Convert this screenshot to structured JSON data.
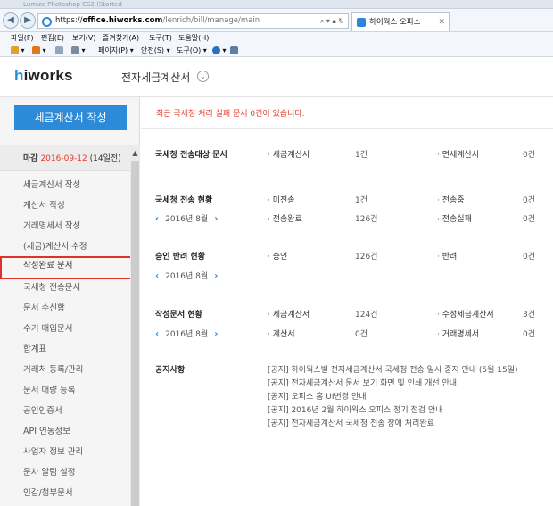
{
  "browser": {
    "window_title": "Lumize Photoshop CS2 (Started",
    "url_scheme": "https://",
    "url_host": "office.hiworks.com",
    "url_path": "/lenrich/bill/manage/main",
    "tab_label": "하이웍스 오피스",
    "menu": [
      "파일(F)",
      "편집(E)",
      "보기(V)",
      "즐겨찾기(A)",
      "도구(T)",
      "도움말(H)"
    ],
    "commands": [
      "페이지(P) ▾",
      "안전(S) ▾",
      "도구(O) ▾"
    ]
  },
  "header": {
    "logo_h": "h",
    "logo_rest": "iworks",
    "app_title": "전자세금계산서"
  },
  "sidebar": {
    "write_button": "세금계산서 작성",
    "deadline_label": "마감",
    "deadline_date": "2016-09-12",
    "deadline_remaining": "(14일전)",
    "items": [
      "세금계산서 작성",
      "계산서 작성",
      "거래명세서 작성",
      "(세금)계산서 수정",
      "작성완료 문서",
      "국세청 전송문서",
      "문서 수신함",
      "수기 매입문서",
      "합계표",
      "거래처 등록/관리",
      "문서 대량 등록",
      "공인인증서",
      "API 연동정보",
      "사업자 정보 관리",
      "문자 알림 설정",
      "인감/첨부문서"
    ],
    "active_index": 4
  },
  "main": {
    "red_notice": "최근 국세청 처리 실패 문서 0건이 있습니다.",
    "sections": [
      {
        "title": "국세청 전송대상 문서",
        "rows": [
          {
            "a_label": "세금계산서",
            "a_value": "1건",
            "b_label": "면세계산서",
            "b_value": "0건"
          }
        ]
      },
      {
        "title": "국세청 전송 현황",
        "month": "2016년 8월",
        "rows": [
          {
            "a_label": "미전송",
            "a_value": "1건",
            "b_label": "전송중",
            "b_value": "0건"
          },
          {
            "a_label": "전송완료",
            "a_value": "126건",
            "b_label": "전송실패",
            "b_value": "0건"
          }
        ]
      },
      {
        "title": "승인 반려 현황",
        "month": "2016년 8월",
        "rows": [
          {
            "a_label": "승인",
            "a_value": "126건",
            "b_label": "반려",
            "b_value": "0건"
          }
        ]
      },
      {
        "title": "작성문서 현황",
        "month": "2016년 8월",
        "rows": [
          {
            "a_label": "세금계산서",
            "a_value": "124건",
            "b_label": "수정세금계산서",
            "b_value": "3건"
          },
          {
            "a_label": "계산서",
            "a_value": "0건",
            "b_label": "거래명세서",
            "b_value": "0건"
          }
        ]
      }
    ],
    "notice_title": "공지사항",
    "notices": [
      "[공지] 하이웍스빌 전자세금계산서 국세청 전송 일시 중지 안내 (5월 15일)",
      "[공지] 전자세금계산서 문서 보기 화면 및 인쇄 개선 안내",
      "[공지] 오피스 홈 UI변경 안내",
      "[공지] 2016년 2월 하이웍스 오피스 정기 점검 안내",
      "[공지] 전자세금계산서 국세청 전송 장애 처리완료"
    ]
  },
  "colors": {
    "accent_blue": "#2c8ad8",
    "alert_red": "#e43a2a",
    "highlight_border": "#e0312b"
  },
  "icons": [
    "back-icon",
    "forward-icon",
    "ie-logo-icon",
    "search-icon",
    "lock-icon",
    "refresh-icon",
    "close-icon",
    "chevron-down-icon",
    "chevron-left-icon",
    "chevron-right-icon",
    "scroll-up-icon"
  ]
}
